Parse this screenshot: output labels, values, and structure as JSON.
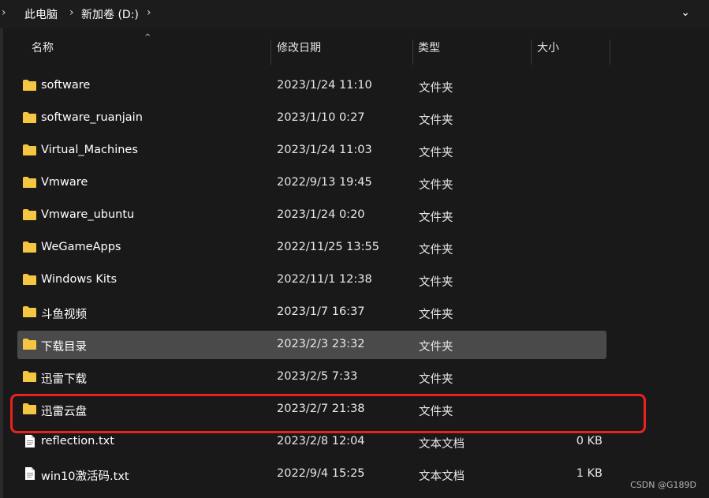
{
  "breadcrumb": {
    "items": [
      "此电脑",
      "新加卷 (D:)"
    ]
  },
  "columns": {
    "name": "名称",
    "date": "修改日期",
    "type": "类型",
    "size": "大小"
  },
  "rows": [
    {
      "name": "software",
      "date": "2023/1/24 11:10",
      "type": "文件夹",
      "size": "",
      "icon": "folder-icon"
    },
    {
      "name": "software_ruanjain",
      "date": "2023/1/10 0:27",
      "type": "文件夹",
      "size": "",
      "icon": "folder-icon"
    },
    {
      "name": "Virtual_Machines",
      "date": "2023/1/24 11:03",
      "type": "文件夹",
      "size": "",
      "icon": "folder-icon"
    },
    {
      "name": "Vmware",
      "date": "2022/9/13 19:45",
      "type": "文件夹",
      "size": "",
      "icon": "folder-icon"
    },
    {
      "name": "Vmware_ubuntu",
      "date": "2023/1/24 0:20",
      "type": "文件夹",
      "size": "",
      "icon": "folder-icon"
    },
    {
      "name": "WeGameApps",
      "date": "2022/11/25 13:55",
      "type": "文件夹",
      "size": "",
      "icon": "folder-icon"
    },
    {
      "name": "Windows Kits",
      "date": "2022/11/1 12:38",
      "type": "文件夹",
      "size": "",
      "icon": "folder-icon"
    },
    {
      "name": "斗鱼视频",
      "date": "2023/1/7 16:37",
      "type": "文件夹",
      "size": "",
      "icon": "folder-icon"
    },
    {
      "name": "下载目录",
      "date": "2023/2/3 23:32",
      "type": "文件夹",
      "size": "",
      "icon": "folder-icon",
      "selected": true
    },
    {
      "name": "迅雷下载",
      "date": "2023/2/5 7:33",
      "type": "文件夹",
      "size": "",
      "icon": "folder-icon"
    },
    {
      "name": "迅雷云盘",
      "date": "2023/2/7 21:38",
      "type": "文件夹",
      "size": "",
      "icon": "folder-icon"
    },
    {
      "name": "reflection.txt",
      "date": "2023/2/8 12:04",
      "type": "文本文档",
      "size": "0 KB",
      "icon": "text-file-icon"
    },
    {
      "name": "win10激活码.txt",
      "date": "2022/9/4 15:25",
      "type": "文本文档",
      "size": "1 KB",
      "icon": "text-file-icon"
    }
  ],
  "colors": {
    "folder": "#f5c542",
    "selected_row": "#4a4a4a",
    "highlight": "#e8221c"
  },
  "watermark": "CSDN @G189D"
}
